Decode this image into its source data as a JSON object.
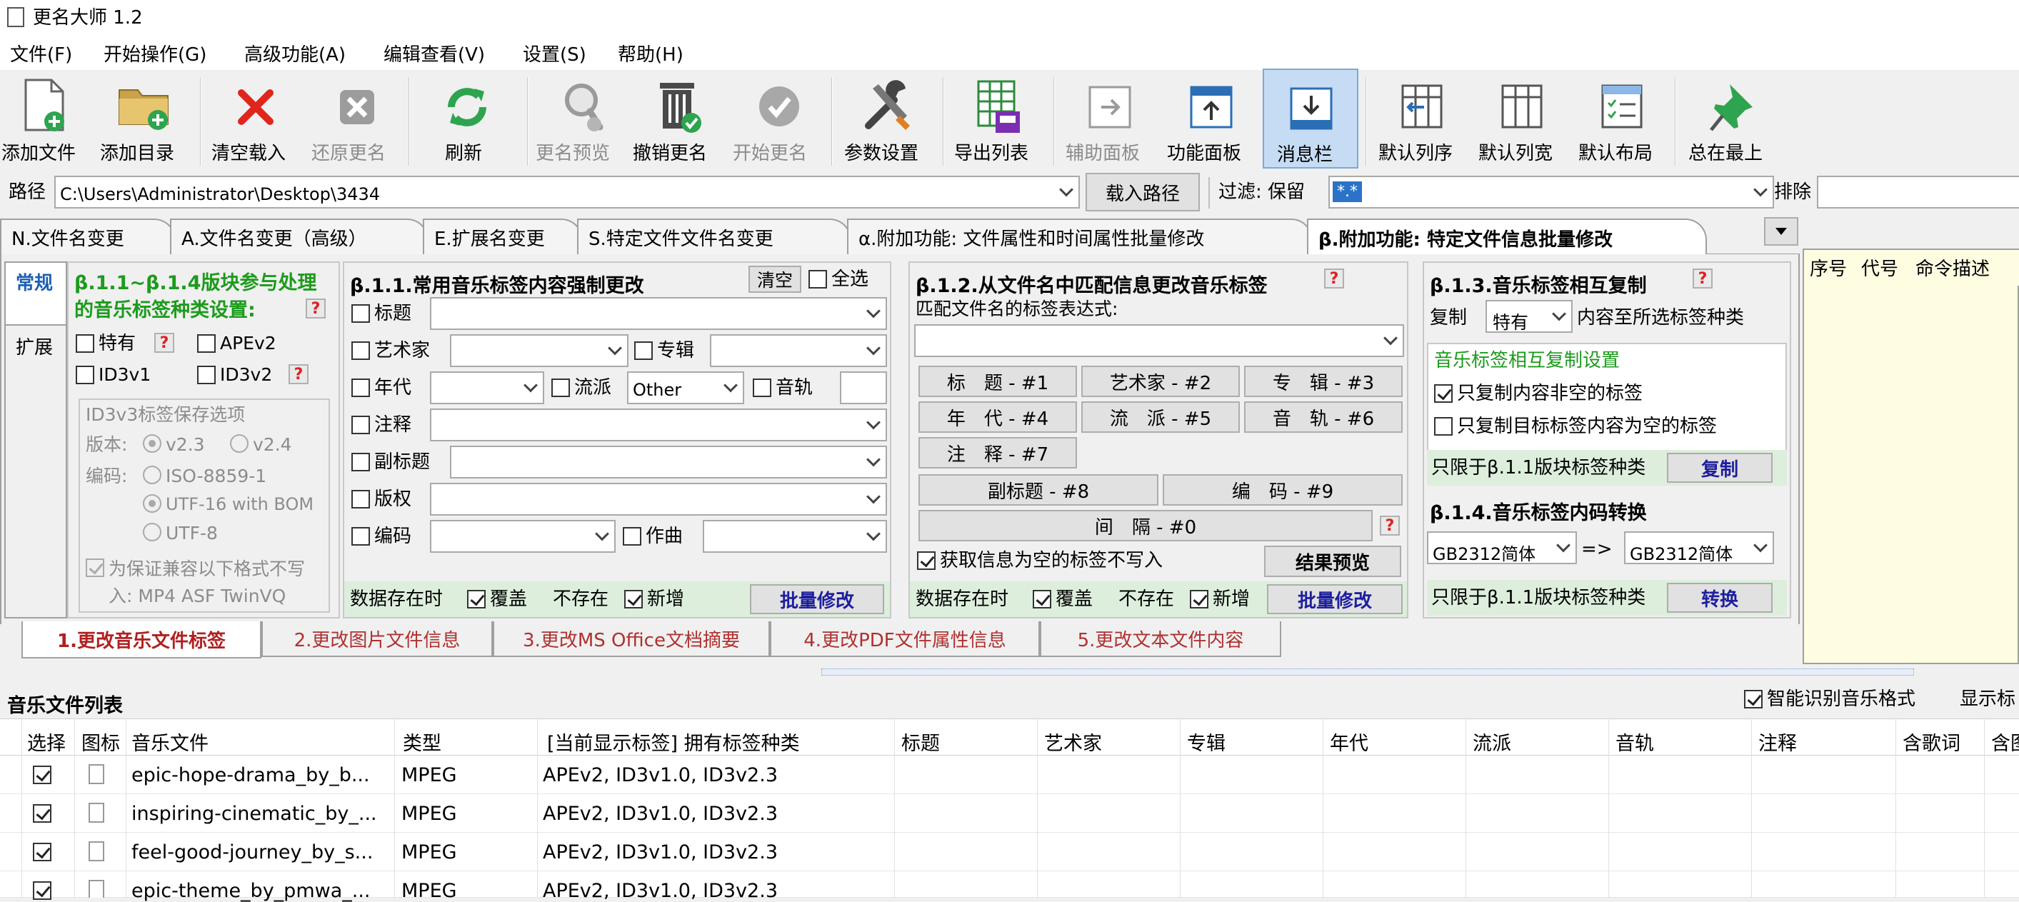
{
  "window": {
    "title": "更名大师 1.2"
  },
  "menu": [
    "文件(F)",
    "开始操作(G)",
    "高级功能(A)",
    "编辑查看(V)",
    "设置(S)",
    "帮助(H)"
  ],
  "toolbar": {
    "add_file": "添加文件",
    "add_dir": "添加目录",
    "clear_load": "清空载入",
    "restore_rename": "还原更名",
    "refresh": "刷新",
    "rename_preview": "更名预览",
    "undo_rename": "撤销更名",
    "start_rename": "开始更名",
    "params": "参数设置",
    "export_list": "导出列表",
    "aux_panel": "辅助面板",
    "func_panel": "功能面板",
    "msg_bar": "消息栏",
    "default_col_order": "默认列序",
    "default_col_width": "默认列宽",
    "default_layout": "默认布局",
    "always_top": "总在最上"
  },
  "pathbar": {
    "label": "路径",
    "value": "C:\\Users\\Administrator\\Desktop\\3434",
    "load_btn": "载入路径",
    "filter_label": "过滤: 保留",
    "filter_value": "*.*",
    "exclude_label": "排除"
  },
  "tabs": [
    "N.文件名变更",
    "A.文件名变更（高级）",
    "E.扩展名变更",
    "S.特定文件文件名变更",
    "α.附加功能: 文件属性和时间属性批量修改",
    "β.附加功能: 特定文件信息批量修改"
  ],
  "side_tabs": {
    "normal": "常规",
    "ext": "扩展"
  },
  "panel1": {
    "title": "β.1.1~β.1.4版块参与处理的音乐标签种类设置:",
    "cb_special": "特有",
    "cb_apev2": "APEv2",
    "cb_id3v1": "ID3v1",
    "cb_id3v2": "ID3v2",
    "save_title": "ID3v3标签保存选项",
    "version_label": "版本:",
    "v23": "v2.3",
    "v24": "v2.4",
    "encoding_label": "编码:",
    "enc1": "ISO-8859-1",
    "enc2": "UTF-16 with BOM",
    "enc3": "UTF-8",
    "compat": "为保证兼容以下格式不写入: MP4 ASF TwinVQ"
  },
  "panel2": {
    "title": "β.1.1.常用音乐标签内容强制更改",
    "clear": "清空",
    "select_all": "全选",
    "title_lbl": "标题",
    "artist": "艺术家",
    "album": "专辑",
    "year": "年代",
    "genre": "流派",
    "genre_value": "Other",
    "track": "音轨",
    "comment": "注释",
    "subtitle": "副标题",
    "copyright": "版权",
    "encoding": "编码",
    "composer": "作曲",
    "footer_exist": "数据存在时",
    "overwrite": "覆盖",
    "not_exist": "不存在",
    "add_new": "新增",
    "batch": "批量修改"
  },
  "panel3": {
    "title": "β.1.2.从文件名中匹配信息更改音乐标签",
    "expr_label": "匹配文件名的标签表达式:",
    "tokens": [
      "标　题 - #1",
      "艺术家 - #2",
      "专　辑 - #3",
      "年　代 - #4",
      "流　派 - #5",
      "音　轨 - #6",
      "注　释 - #7",
      "副标题 - #8",
      "编　码 - #9",
      "间　隔 - #0"
    ],
    "skip_empty": "获取信息为空的标签不写入",
    "preview": "结果预览",
    "footer_exist": "数据存在时",
    "overwrite": "覆盖",
    "not_exist": "不存在",
    "add_new": "新增",
    "batch": "批量修改"
  },
  "panel4": {
    "title": "β.1.3.音乐标签相互复制",
    "copy_label": "复制",
    "copy_value": "特有",
    "copy_suffix": "内容至所选标签种类",
    "group": "音乐标签相互复制设置",
    "opt1": "只复制内容非空的标签",
    "opt2": "只复制目标标签内容为空的标签",
    "limit": "只限于β.1.1版块标签种类",
    "copy_btn": "复制",
    "title2": "β.1.4.音乐标签内码转换",
    "from": "GB2312简体",
    "arrow": "=>",
    "to": "GB2312简体",
    "limit2": "只限于β.1.1版块标签种类",
    "convert_btn": "转换"
  },
  "cmd_headers": [
    "序号",
    "代号",
    "命令描述"
  ],
  "bottom_tabs": [
    "1.更改音乐文件标签",
    "2.更改图片文件信息",
    "3.更改MS Office文档摘要",
    "4.更改PDF文件属性信息",
    "5.更改文本文件内容"
  ],
  "list": {
    "title": "音乐文件列表",
    "smart": "智能识别音乐格式",
    "show": "显示标",
    "headers": [
      "选择",
      "图标",
      "音乐文件",
      "类型",
      "[当前显示标签] 拥有标签种类",
      "标题",
      "艺术家",
      "专辑",
      "年代",
      "流派",
      "音轨",
      "注释",
      "含歌词",
      "含图"
    ],
    "rows": [
      {
        "file": "epic-hope-drama_by_b...",
        "type": "MPEG",
        "tags": "APEv2, ID3v1.0, ID3v2.3"
      },
      {
        "file": "inspiring-cinematic_by_...",
        "type": "MPEG",
        "tags": "APEv2, ID3v1.0, ID3v2.3"
      },
      {
        "file": "feel-good-journey_by_s...",
        "type": "MPEG",
        "tags": "APEv2, ID3v1.0, ID3v2.3"
      },
      {
        "file": "epic-theme_by_pmwa_...",
        "type": "MPEG",
        "tags": "APEv2, ID3v1.0, ID3v2.3"
      }
    ]
  }
}
